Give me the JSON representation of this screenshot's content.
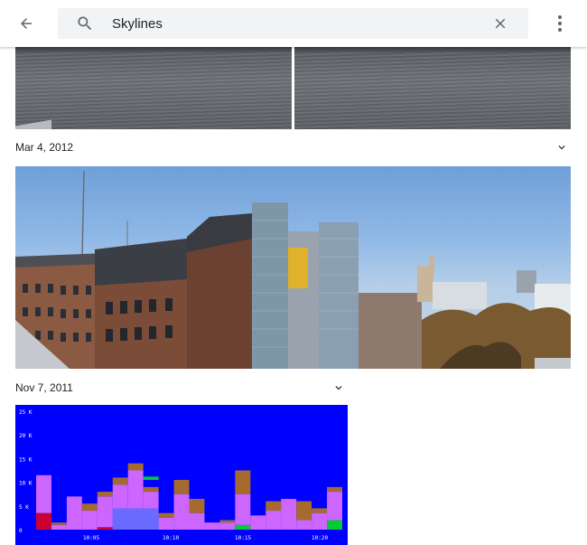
{
  "search": {
    "query": "Skylines"
  },
  "groups": [
    {
      "date": "Mar 4, 2012"
    },
    {
      "date": "Nov 7, 2011"
    }
  ],
  "icons": {
    "back": "arrow-left-icon",
    "search": "search-icon",
    "clear": "close-icon",
    "more": "more-vertical-icon",
    "expand": "chevron-down-icon"
  },
  "chart_data": {
    "type": "bar",
    "y_ticks": [
      "25 K",
      "20 K",
      "15 K",
      "10 K",
      "5 K",
      "0"
    ],
    "x_ticks": [
      "10:05",
      "10:10",
      "10:15",
      "10:20"
    ],
    "ylim": [
      0,
      25
    ],
    "colors": {
      "background": "#0000ff",
      "violet": "#cc66ff",
      "brown": "#a66a2e",
      "red": "#cc0033",
      "green": "#00cc33",
      "slate": "#6a6aff"
    },
    "bars": [
      {
        "x": 0,
        "w": 1,
        "stack": [
          [
            "red",
            3.5
          ],
          [
            "violet",
            8
          ]
        ]
      },
      {
        "x": 1,
        "w": 1,
        "stack": [
          [
            "violet",
            1
          ],
          [
            "brown",
            0.5
          ]
        ]
      },
      {
        "x": 2,
        "w": 1,
        "stack": [
          [
            "violet",
            7
          ]
        ]
      },
      {
        "x": 3,
        "w": 1,
        "stack": [
          [
            "violet",
            4
          ],
          [
            "brown",
            1.5
          ]
        ]
      },
      {
        "x": 4,
        "w": 1,
        "stack": [
          [
            "red",
            0.5
          ],
          [
            "violet",
            6.5
          ],
          [
            "brown",
            1
          ]
        ]
      },
      {
        "x": 5,
        "w": 1,
        "stack": [
          [
            "violet",
            9.5
          ],
          [
            "brown",
            1.5
          ]
        ]
      },
      {
        "x": 6,
        "w": 1,
        "stack": [
          [
            "violet",
            12.5
          ],
          [
            "brown",
            1.5
          ]
        ]
      },
      {
        "x": 7,
        "w": 1,
        "stack": [
          [
            "violet",
            8
          ],
          [
            "brown",
            1
          ]
        ]
      },
      {
        "x": 8,
        "w": 1,
        "stack": [
          [
            "violet",
            2.5
          ],
          [
            "brown",
            1
          ]
        ]
      },
      {
        "x": 9,
        "w": 1,
        "stack": [
          [
            "violet",
            7.5
          ],
          [
            "brown",
            3
          ]
        ]
      },
      {
        "x": 10,
        "w": 1,
        "stack": [
          [
            "violet",
            3.5
          ],
          [
            "brown",
            3
          ]
        ]
      },
      {
        "x": 11,
        "w": 1,
        "stack": [
          [
            "violet",
            1.5
          ]
        ]
      },
      {
        "x": 12,
        "w": 1,
        "stack": [
          [
            "violet",
            1.5
          ],
          [
            "brown",
            0.5
          ]
        ]
      },
      {
        "x": 13,
        "w": 1,
        "stack": [
          [
            "green",
            1
          ],
          [
            "violet",
            6.5
          ],
          [
            "brown",
            5
          ]
        ]
      },
      {
        "x": 14,
        "w": 1,
        "stack": [
          [
            "violet",
            3
          ]
        ]
      },
      {
        "x": 15,
        "w": 1,
        "stack": [
          [
            "violet",
            4
          ],
          [
            "brown",
            2
          ]
        ]
      },
      {
        "x": 16,
        "w": 1,
        "stack": [
          [
            "violet",
            6.5
          ]
        ]
      },
      {
        "x": 17,
        "w": 1,
        "stack": [
          [
            "violet",
            2
          ],
          [
            "brown",
            4
          ]
        ]
      },
      {
        "x": 18,
        "w": 1,
        "stack": [
          [
            "violet",
            3.5
          ],
          [
            "brown",
            1
          ]
        ]
      },
      {
        "x": 19,
        "w": 1,
        "stack": [
          [
            "green",
            2
          ],
          [
            "violet",
            6
          ],
          [
            "brown",
            1
          ]
        ]
      }
    ],
    "overlays": [
      {
        "x": 4,
        "w": 1,
        "color": "red",
        "value": 0.5
      },
      {
        "x": 5,
        "w": 3,
        "color": "slate",
        "value": 4.5
      },
      {
        "x": 7,
        "w": 1,
        "color": "green",
        "value": 10.5
      }
    ]
  }
}
